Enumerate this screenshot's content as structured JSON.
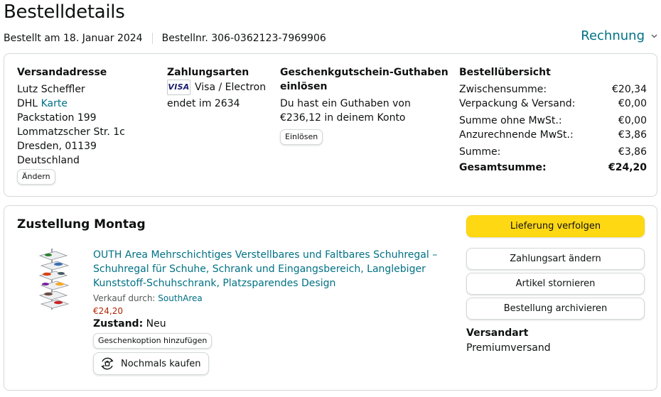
{
  "header": {
    "title": "Bestelldetails",
    "ordered_on": "Bestellt am 18. Januar 2024",
    "order_number": "Bestellnr. 306-0362123-7969906",
    "invoice_label": "Rechnung"
  },
  "address": {
    "heading": "Versandadresse",
    "name": "Lutz Scheffler",
    "carrier": "DHL",
    "card_link": "Karte",
    "line1": "Packstation 199",
    "line2": "Lommatzscher Str. 1c",
    "line3": "Dresden, 01139",
    "country": "Deutschland",
    "change_button": "Ändern"
  },
  "payment": {
    "heading": "Zahlungsarten",
    "card_brand": "VISA",
    "card_type": "Visa / Electron",
    "ending": "endet im 2634"
  },
  "gift": {
    "heading": "Geschenkgutschein-Guthaben einlösen",
    "text": "Du hast ein Guthaben von €236,12 in deinem Konto",
    "redeem_button": "Einlösen"
  },
  "summary": {
    "heading": "Bestellübersicht",
    "rows": [
      {
        "label": "Zwischensumme:",
        "value": "€20,34"
      },
      {
        "label": "Verpackung & Versand:",
        "value": "€0,00"
      },
      {
        "label": "Summe ohne MwSt.:",
        "value": "€0,00"
      },
      {
        "label": "Anzurechnende MwSt.:",
        "value": "€3,86"
      },
      {
        "label": "Summe:",
        "value": "€3,86"
      }
    ],
    "total_label": "Gesamtsumme:",
    "total_value": "€24,20"
  },
  "shipment": {
    "title": "Zustellung Montag",
    "product_title": "OUTH Area Mehrschichtiges Verstellbares und Faltbares Schuhregal – Schuhregal für Schuhe, Schrank und Eingangsbereich, Langlebiger Kunststoff-Schuhschrank, Platzsparendes Design",
    "sold_by_label": "Verkauf durch:",
    "seller": "SouthArea",
    "price": "€24,20",
    "condition_label": "Zustand:",
    "condition_value": "Neu",
    "gift_option_button": "Geschenkoption hinzufügen",
    "buy_again_button": "Nochmals kaufen"
  },
  "actions": {
    "track": "Lieferung verfolgen",
    "change_payment": "Zahlungsart ändern",
    "cancel": "Artikel stornieren",
    "archive": "Bestellung archivieren",
    "shipping_type_heading": "Versandart",
    "shipping_type_value": "Premiumversand"
  },
  "colors": {
    "link": "#007185",
    "primary_button": "#FFD814",
    "price": "#B12704",
    "border": "#D5D9D9"
  },
  "icons": [
    "chevron-down-icon",
    "visa-logo-icon",
    "buy-again-icon",
    "product-thumbnail"
  ]
}
